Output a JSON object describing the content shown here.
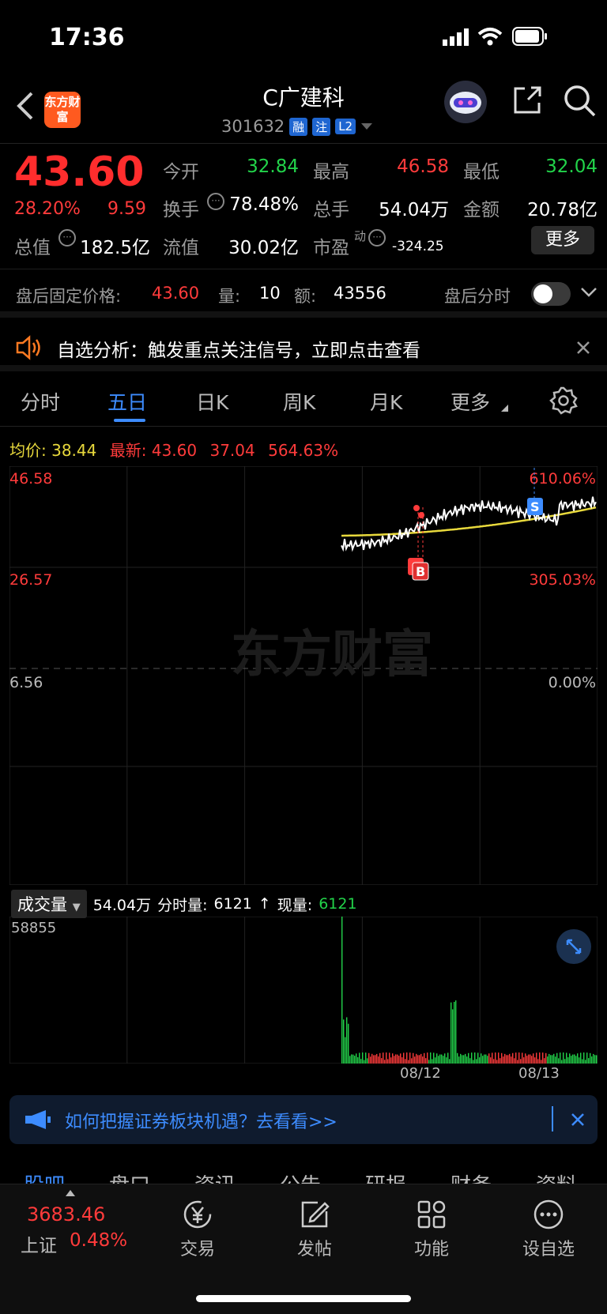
{
  "status": {
    "time": "17:36"
  },
  "header": {
    "logo": "东方财富",
    "name": "C广建科",
    "code": "301632",
    "tags": [
      "融",
      "注",
      "L2"
    ]
  },
  "quote": {
    "price": "43.60",
    "pct": "28.20%",
    "change": "9.59",
    "stats": [
      {
        "label": "今开",
        "value": "32.84",
        "color": "green"
      },
      {
        "label": "最高",
        "value": "46.58",
        "color": "red"
      },
      {
        "label": "最低",
        "value": "32.04",
        "color": "green"
      },
      {
        "label": "换手",
        "value": "78.48%",
        "color": "white"
      },
      {
        "label": "总手",
        "value": "54.04万",
        "color": "white"
      },
      {
        "label": "金额",
        "value": "20.78亿",
        "color": "white"
      },
      {
        "label": "总值",
        "value": "182.5亿",
        "color": "white"
      },
      {
        "label": "流值",
        "value": "30.02亿",
        "color": "white"
      },
      {
        "label": "市盈",
        "value": "-324.25",
        "color": "white"
      }
    ],
    "pe_suffix": "动",
    "more": "更多"
  },
  "after_hours": {
    "label": "盘后固定价格:",
    "price": "43.60",
    "vol_label": "量:",
    "vol": "10",
    "amt_label": "额:",
    "amt": "43556",
    "toggle_label": "盘后分时",
    "toggle_on": false
  },
  "notice": {
    "text": "自选分析：触发重点关注信号，立即点击查看"
  },
  "tabs": [
    "分时",
    "五日",
    "日K",
    "周K",
    "月K",
    "更多"
  ],
  "active_tab": "五日",
  "info": {
    "avg_label": "均价:",
    "avg": "38.44",
    "last_label": "最新:",
    "last": "43.60",
    "chg": "37.04",
    "pct": "564.63%"
  },
  "chart_data": {
    "type": "line",
    "y_left_ticks": [
      "46.58",
      "26.57",
      "6.56"
    ],
    "y_right_ticks": [
      "610.06%",
      "305.03%",
      "0.00%"
    ],
    "ylim": [
      6.56,
      46.58
    ],
    "x_labels": [
      "08/12",
      "08/13"
    ],
    "watermark": "东方财富",
    "series": [
      {
        "name": "价格",
        "color": "#ffffff"
      },
      {
        "name": "均价",
        "color": "#e8d93c"
      }
    ],
    "markers": [
      "B",
      "S"
    ]
  },
  "volume": {
    "selector": "成交量",
    "total": "54.04万",
    "bar_label": "分时量:",
    "bar_value": "6121",
    "now_label": "现量:",
    "now_value": "6121",
    "max_tick": "58855"
  },
  "promo": {
    "text": "如何把握证券板块机遇？去看看>>"
  },
  "subtabs": [
    "股吧",
    "盘口",
    "资讯",
    "公告",
    "研报",
    "财务",
    "资料"
  ],
  "bottom": {
    "index_value": "3683.46",
    "index_name": "上证",
    "index_pct": "0.48%",
    "items": [
      "交易",
      "发帖",
      "功能",
      "设自选"
    ]
  }
}
